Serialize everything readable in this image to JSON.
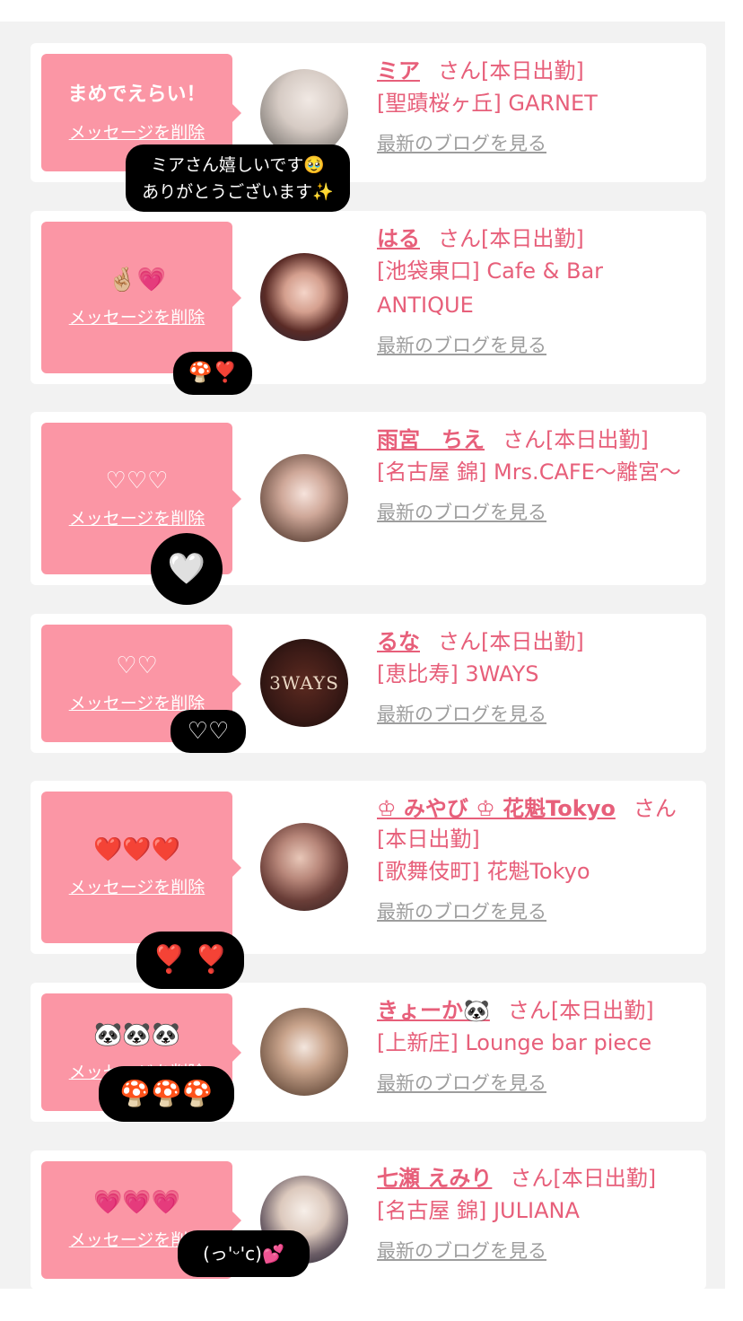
{
  "delete_label": "メッセージを削除",
  "san_label": "さん[本日出勤]",
  "blog_label": "最新のブログを見る",
  "colors": {
    "bubble": "#fb96a5",
    "accent": "#e75f7a",
    "muted": "#9d9d9d",
    "reply_bg": "#000000",
    "page_bg": "#f2f2f2"
  },
  "cards": [
    {
      "message": "まめでえらい！",
      "name": "ミア",
      "shop": "[聖蹟桜ヶ丘] GARNET",
      "reply": "ミアさん嬉しいです🥹\nありがとうございます✨"
    },
    {
      "message": "🤞🏼💗",
      "name": "はる",
      "shop": "[池袋東口] Cafe & Bar ANTIQUE",
      "reply": "🍄❣️"
    },
    {
      "message": "♡♡♡",
      "name": "雨宮　ちえ",
      "shop": "[名古屋 錦] Mrs.CAFE〜離宮〜",
      "reply": "🤍"
    },
    {
      "message": "♡♡",
      "name": "るな",
      "shop": "[恵比寿] 3WAYS",
      "reply": "♡♡",
      "avatar_text": "3WAYS"
    },
    {
      "message": "❤️❤️❤️",
      "name": "♔ みやび ♔ 花魁Tokyo",
      "shop": "[歌舞伎町] 花魁Tokyo",
      "san_prefix": "さん",
      "san_suffix": "[本日出勤]",
      "reply": "❣️ ❣️"
    },
    {
      "message": "🐼🐼🐼",
      "name": "きょーか🐼",
      "shop": "[上新庄] Lounge bar piece",
      "reply": "🍄🍄🍄"
    },
    {
      "message": "💗💗💗",
      "name": "七瀬 えみり",
      "shop": "[名古屋 錦] JULIANA",
      "reply": "(っ'ᵕ'c)💕"
    }
  ]
}
